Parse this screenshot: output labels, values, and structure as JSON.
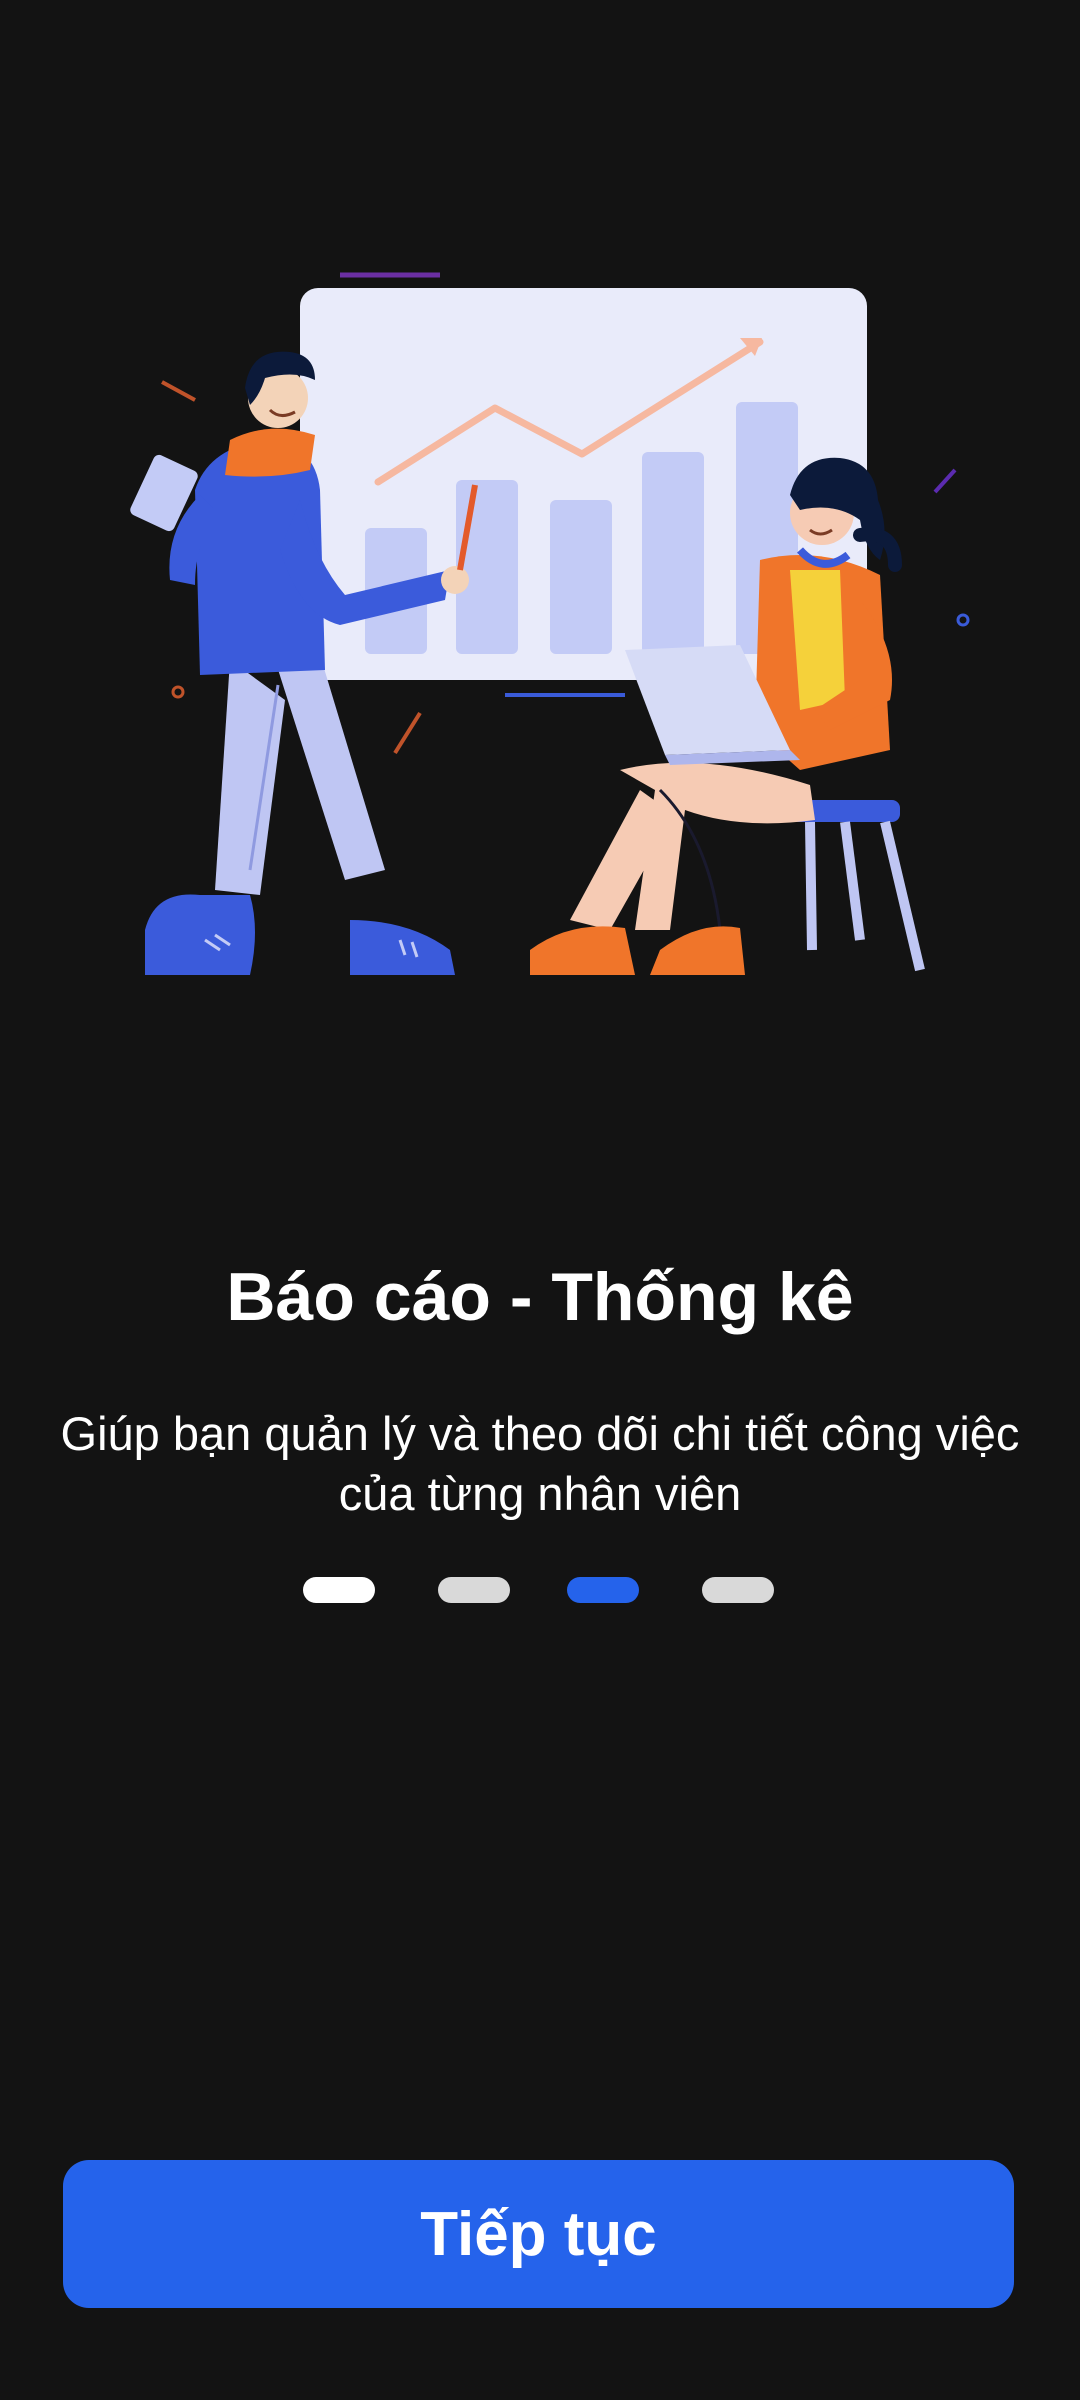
{
  "onboarding": {
    "illustration_icon": "presentation-analytics-illustration",
    "title": "Báo cáo - Thống kê",
    "subtitle": "Giúp bạn quản lý và theo dõi chi tiết công việc của từng nhân viên",
    "page_indicator": {
      "total": 4,
      "current_index": 2
    },
    "continue_button_label": "Tiếp tục"
  },
  "colors": {
    "background": "#131313",
    "primary": "#2563eb",
    "indicator_inactive": "#d9d9d9",
    "indicator_first": "#ffffff",
    "text": "#ffffff"
  }
}
